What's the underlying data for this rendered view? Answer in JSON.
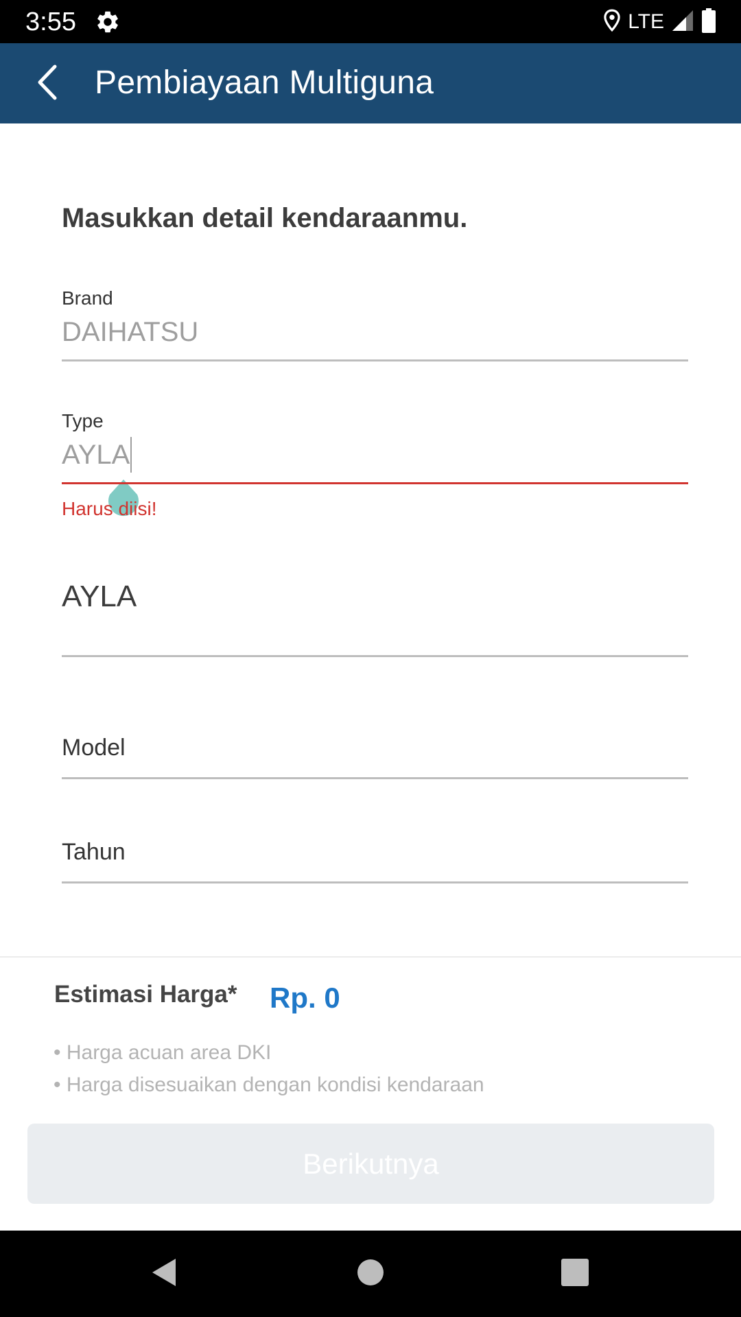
{
  "status_bar": {
    "time": "3:55",
    "network": "LTE",
    "icons": [
      "settings-gear-icon",
      "location-icon",
      "signal-icon",
      "battery-icon"
    ]
  },
  "app_bar": {
    "title": "Pembiayaan Multiguna",
    "back_icon": "chevron-left-icon",
    "background_color": "#1b4a72"
  },
  "form": {
    "heading": "Masukkan detail kendaraanmu.",
    "brand": {
      "label": "Brand",
      "value": "DAIHATSU"
    },
    "type": {
      "label": "Type",
      "value": "AYLA",
      "error": "Harus diisi!"
    },
    "type_select": {
      "value": "AYLA"
    },
    "model": {
      "placeholder": "Model"
    },
    "year": {
      "placeholder": "Tahun"
    }
  },
  "estimate": {
    "label": "Estimasi Harga*",
    "value": "Rp. 0",
    "notes": [
      "• Harga acuan area DKI",
      "• Harga disesuaikan dengan kondisi kendaraan"
    ],
    "accent_color": "#1f78c8"
  },
  "actions": {
    "next_label": "Berikutnya"
  },
  "colors": {
    "error": "#d1342f",
    "cursor_handle": "#80cbc4"
  },
  "nav_bar": {
    "icons": [
      "back-triangle-icon",
      "home-circle-icon",
      "recents-square-icon"
    ]
  }
}
